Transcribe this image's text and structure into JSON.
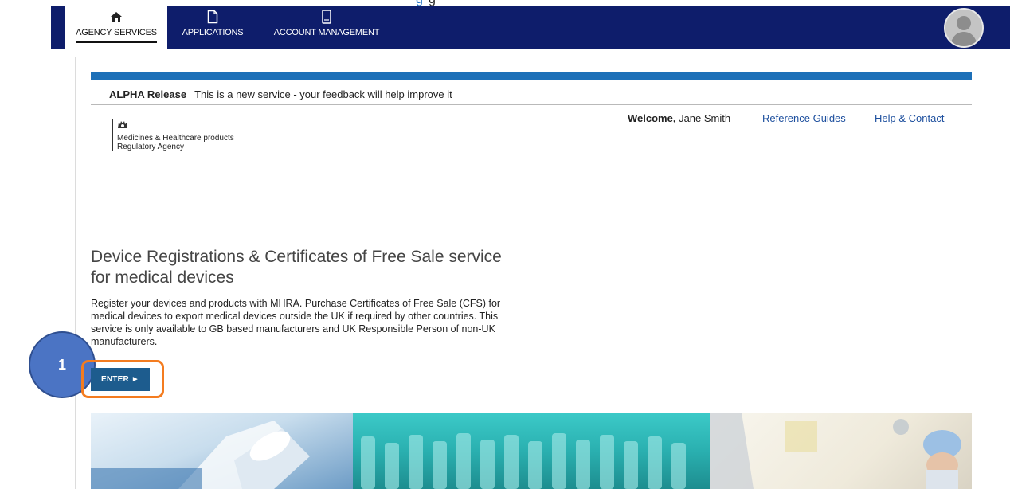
{
  "nav": {
    "tabs": [
      {
        "label": "AGENCY SERVICES",
        "icon": "home-icon",
        "active": true
      },
      {
        "label": "APPLICATIONS",
        "icon": "document-icon",
        "active": false
      },
      {
        "label": "ACCOUNT MANAGEMENT",
        "icon": "tablet-icon",
        "active": false
      }
    ],
    "avatar_icon": "user-avatar-icon"
  },
  "banner": {
    "phase_label": "ALPHA Release",
    "phase_text": "This is a new service - your feedback will help improve it"
  },
  "org": {
    "line1": "Medicines & Healthcare products",
    "line2": "Regulatory Agency"
  },
  "user": {
    "welcome_label": "Welcome,",
    "name": "Jane Smith",
    "links": [
      "Reference Guides",
      "Help & Contact"
    ]
  },
  "main": {
    "title": "Device Registrations & Certificates of Free Sale service for medical devices",
    "description": "Register your devices and products with MHRA. Purchase Certificates of Free Sale (CFS) for medical devices to export medical devices outside the UK if required by other countries. This service is only available to GB based manufacturers and UK Responsible Person of non-UK manufacturers.",
    "enter_label": "ENTER ►"
  },
  "annotation": {
    "step_number": "1",
    "highlight_color": "#f47c20",
    "badge_color": "#4b74c4"
  },
  "colors": {
    "nav_background": "#0e1d6b",
    "phase_bar": "#1d70b8",
    "link": "#1d4f9e",
    "button": "#1d5c8e"
  }
}
